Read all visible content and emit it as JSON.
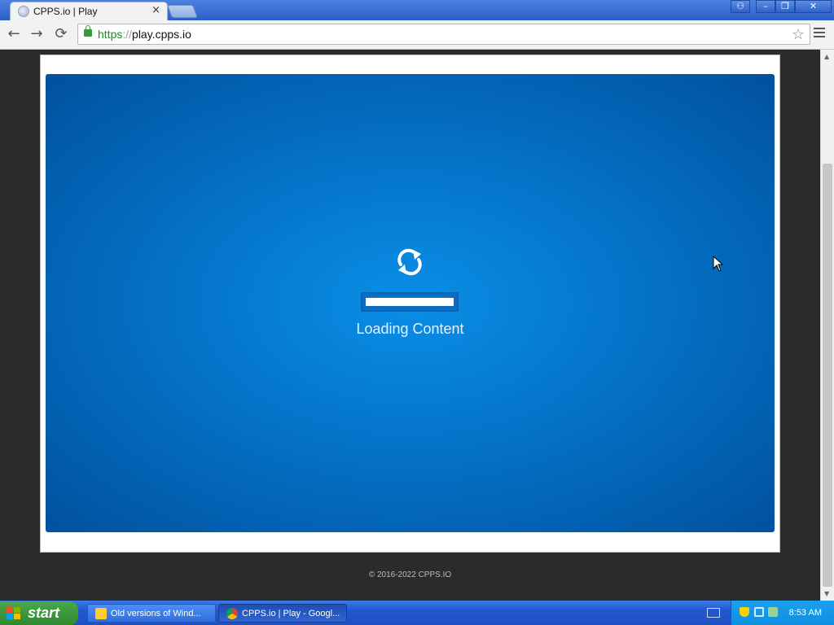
{
  "browser": {
    "tab": {
      "title": "CPPS.io | Play",
      "close_icon": "×"
    },
    "window_controls": {
      "user_icon": "⚇",
      "minimize_icon": "–",
      "restore_icon": "❐",
      "close_icon": "✕"
    },
    "nav": {
      "back_icon": "←",
      "forward_icon": "→",
      "reload_icon": "⟳"
    },
    "address": {
      "scheme": "https",
      "separator": "://",
      "host": "play.cpps.io"
    },
    "bookmark_icon": "☆"
  },
  "page": {
    "loading_label": "Loading Content",
    "progress_fraction": 1.0,
    "footer": "© 2016-2022 CPPS.IO",
    "colors": {
      "stage_center": "#0a8ee6",
      "stage_edge": "#01519e"
    }
  },
  "scrollbar": {
    "up_icon": "▲",
    "down_icon": "▼"
  },
  "taskbar": {
    "start_label": "start",
    "tasks": [
      {
        "label": "Old versions of Wind..."
      },
      {
        "label": "CPPS.io | Play - Googl..."
      }
    ],
    "clock": "8:53 AM"
  }
}
